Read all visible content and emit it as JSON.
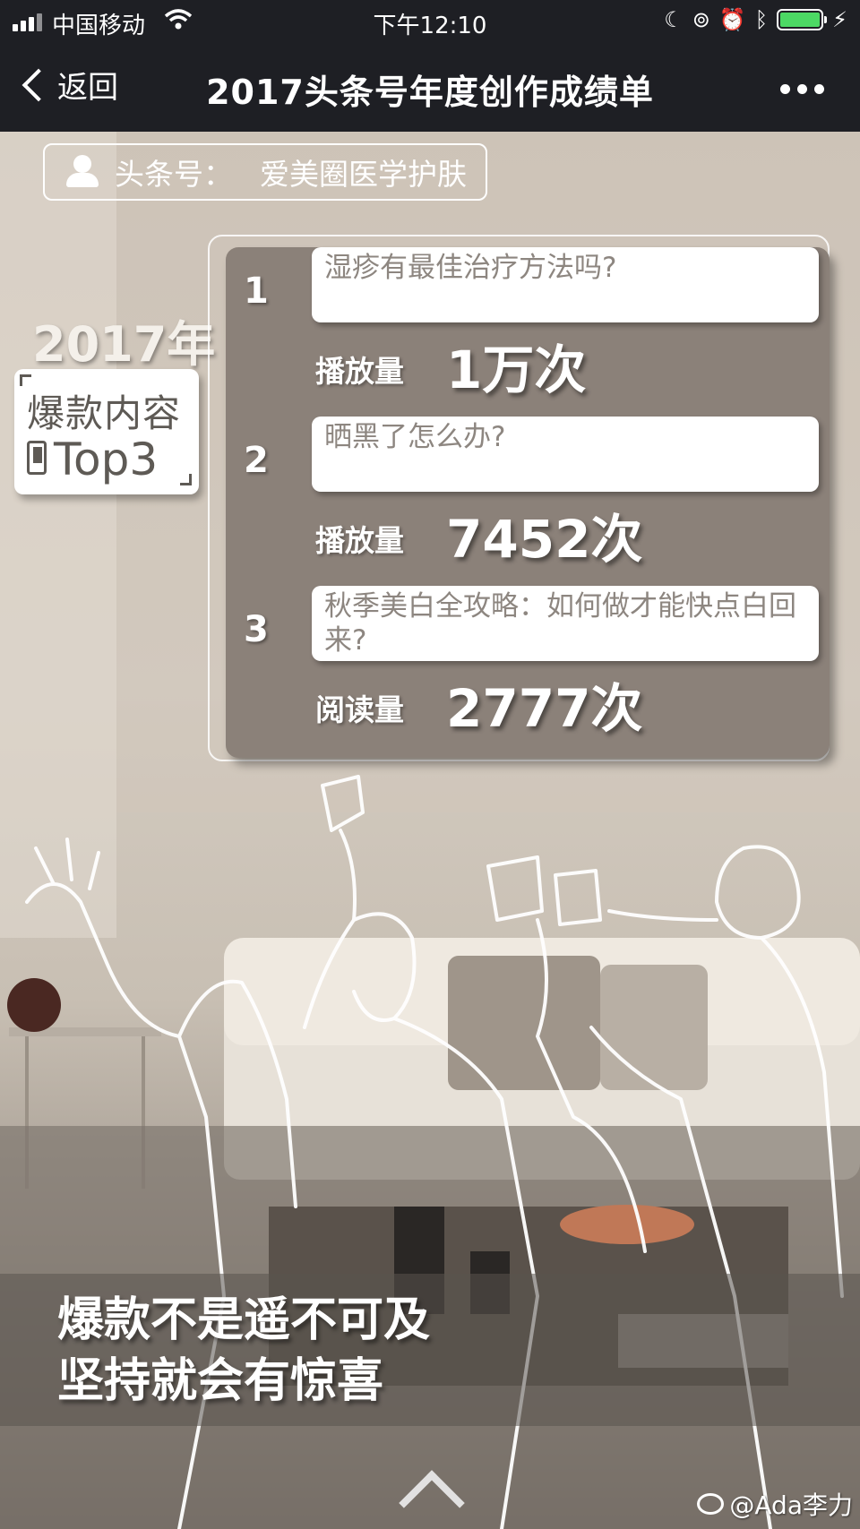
{
  "status_bar": {
    "carrier": "中国移动",
    "time": "下午12:10",
    "icons": [
      "signal-icon",
      "wifi-icon",
      "moon-icon",
      "orientation-lock-icon",
      "alarm-icon",
      "bluetooth-icon",
      "battery-icon",
      "charging-icon"
    ]
  },
  "nav": {
    "back_label": "返回",
    "title": "2017头条号年度创作成绩单",
    "more_icon": "more-dots-icon"
  },
  "author": {
    "label": "头条号：",
    "name": "爱美圈医学护肤"
  },
  "badge": {
    "year": "2017年",
    "line1": "爆款内容",
    "line2": "Top3"
  },
  "top3": [
    {
      "rank": "1",
      "title": "湿疹有最佳治疗方法吗?",
      "metric_label": "播放量",
      "metric_value": "1万次"
    },
    {
      "rank": "2",
      "title": "晒黑了怎么办?",
      "metric_label": "播放量",
      "metric_value": "7452次"
    },
    {
      "rank": "3",
      "title": "秋季美白全攻略：如何做才能快点白回来?",
      "metric_label": "阅读量",
      "metric_value": "2777次"
    }
  ],
  "slogan": {
    "line1": "爆款不是遥不可及",
    "line2": "坚持就会有惊喜"
  },
  "watermark": "@Ada李力",
  "colors": {
    "nav_bg": "#1e1f24",
    "panel_bg": "#8b8179",
    "battery": "#4cd964"
  }
}
